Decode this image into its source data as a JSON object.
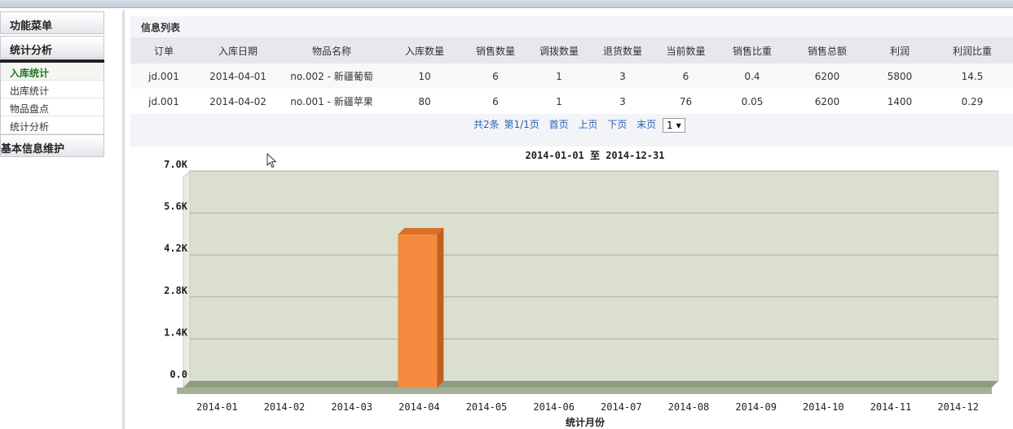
{
  "sidebar": {
    "menu_title": "功能菜单",
    "group_title": "统计分析",
    "items": [
      {
        "label": "入库统计",
        "active": true
      },
      {
        "label": "出库统计",
        "active": false
      },
      {
        "label": "物品盘点",
        "active": false
      },
      {
        "label": "统计分析",
        "active": false
      }
    ],
    "group2_title": "基本信息维护"
  },
  "panel": {
    "title": "信息列表",
    "columns": [
      "订单",
      "入库日期",
      "物品名称",
      "入库数量",
      "销售数量",
      "调拨数量",
      "退货数量",
      "当前数量",
      "销售比重",
      "销售总额",
      "利润",
      "利润比重"
    ],
    "rows": [
      [
        "jd.001",
        "2014-04-01",
        "no.002 - 新疆葡萄",
        "10",
        "6",
        "1",
        "3",
        "6",
        "0.4",
        "6200",
        "5800",
        "14.5"
      ],
      [
        "jd.001",
        "2014-04-02",
        "no.001 - 新疆苹果",
        "80",
        "6",
        "1",
        "3",
        "76",
        "0.05",
        "6200",
        "1400",
        "0.29"
      ]
    ],
    "pager": {
      "total": "共2条",
      "page": "第1/1页",
      "first": "首页",
      "prev": "上页",
      "next": "下页",
      "last": "末页",
      "page_select": "1"
    }
  },
  "chart_data": {
    "type": "bar",
    "title": "2014-01-01 至 2014-12-31",
    "xlabel": "统计月份",
    "ylabel": "",
    "categories": [
      "2014-01",
      "2014-02",
      "2014-03",
      "2014-04",
      "2014-05",
      "2014-06",
      "2014-07",
      "2014-08",
      "2014-09",
      "2014-10",
      "2014-11",
      "2014-12"
    ],
    "values": [
      0,
      0,
      0,
      5100,
      0,
      0,
      0,
      0,
      0,
      0,
      0,
      0
    ],
    "yticks": [
      "0.0",
      "1.4K",
      "2.8K",
      "4.2K",
      "5.6K",
      "7.0K"
    ],
    "ylim": [
      0,
      7000
    ],
    "grid": true,
    "colors": {
      "bar": "#f58a3e",
      "bar_top": "#d9702a",
      "bar_side": "#c2601f",
      "plot_bg": "#dadfd0",
      "floor": "#8f9c82"
    }
  }
}
